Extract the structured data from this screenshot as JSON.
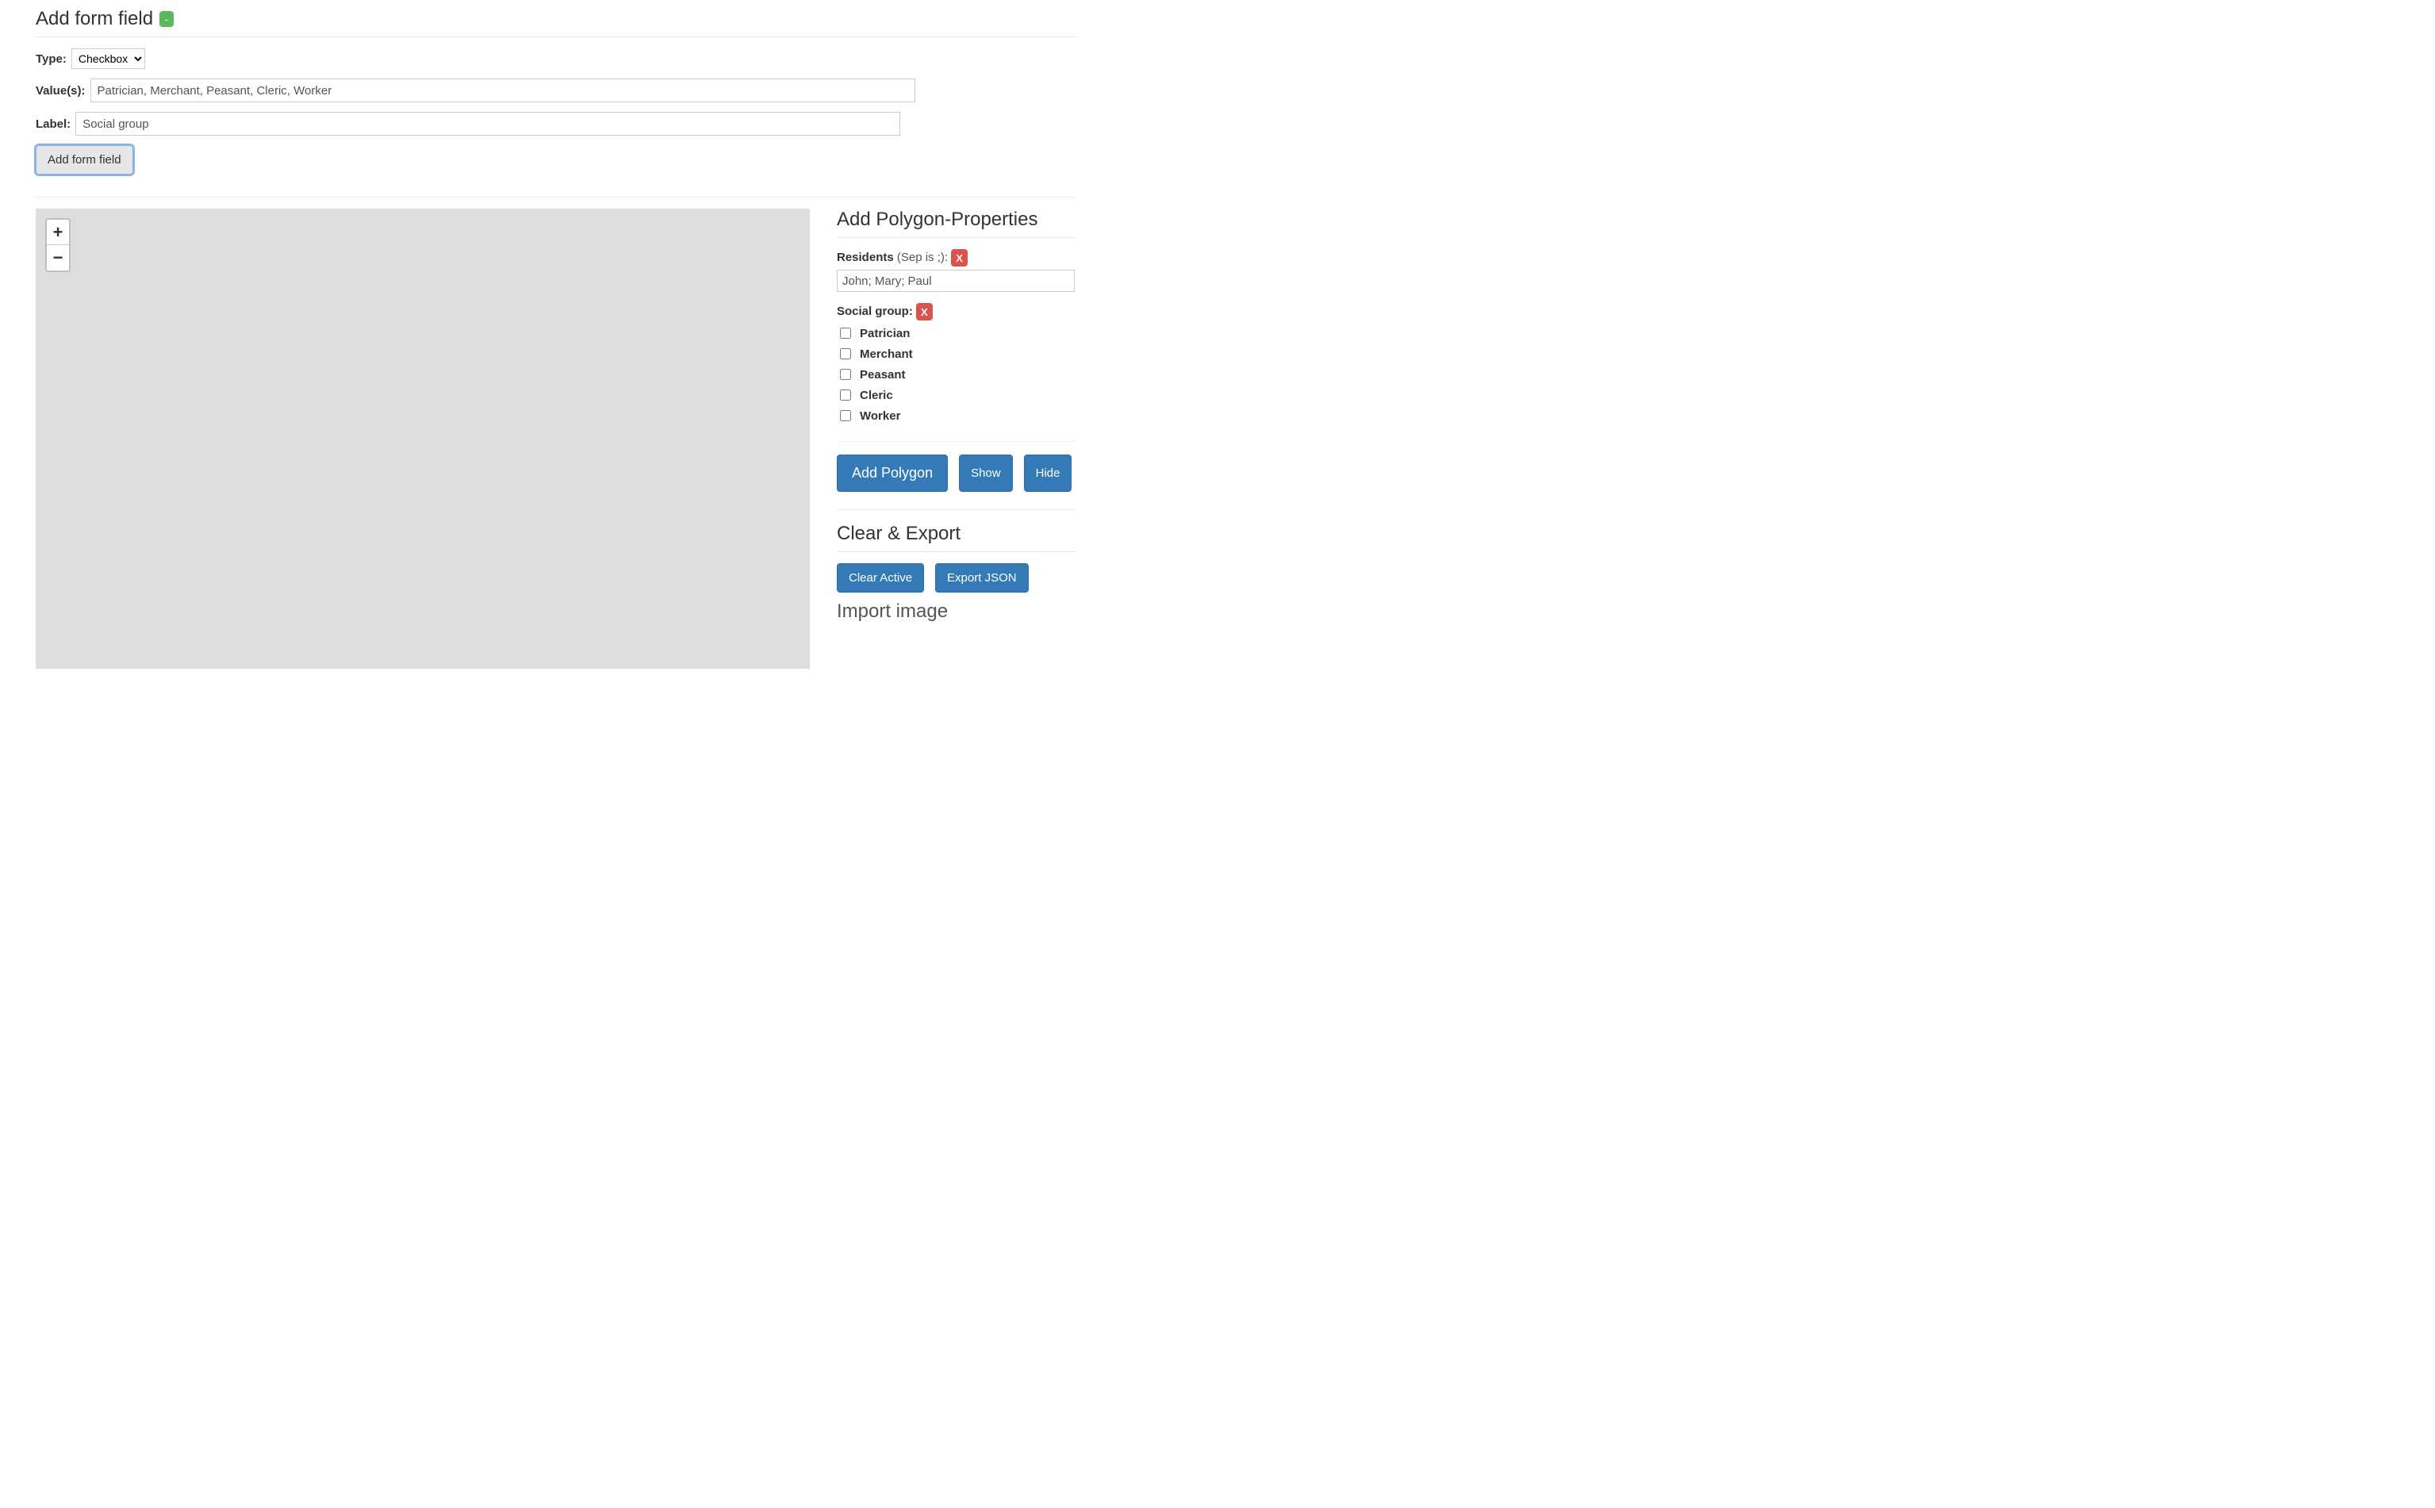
{
  "addFormField": {
    "heading": "Add form field",
    "collapseBadge": "-",
    "typeLabel": "Type:",
    "typeSelected": "Checkbox",
    "typeOptions": [
      "Checkbox"
    ],
    "valuesLabel": "Value(s):",
    "valuesValue": "Patrician, Merchant, Peasant, Cleric, Worker",
    "labelLabel": "Label:",
    "labelValue": "Social group",
    "submitLabel": "Add form field"
  },
  "polygonProps": {
    "heading": "Add Polygon-Properties",
    "residents": {
      "label": "Residents",
      "hint": "(Sep is ;):",
      "deleteBadge": "X",
      "value": "John; Mary; Paul"
    },
    "socialGroup": {
      "label": "Social group:",
      "deleteBadge": "X",
      "options": [
        "Patrician",
        "Merchant",
        "Peasant",
        "Cleric",
        "Worker"
      ]
    },
    "buttons": {
      "addPolygon": "Add Polygon",
      "show": "Show",
      "hide": "Hide"
    }
  },
  "clearExport": {
    "heading": "Clear & Export",
    "clearActive": "Clear Active",
    "exportJson": "Export JSON"
  },
  "importImage": {
    "heading": "Import image"
  },
  "map": {
    "zoomIn": "+",
    "zoomOut": "−"
  }
}
